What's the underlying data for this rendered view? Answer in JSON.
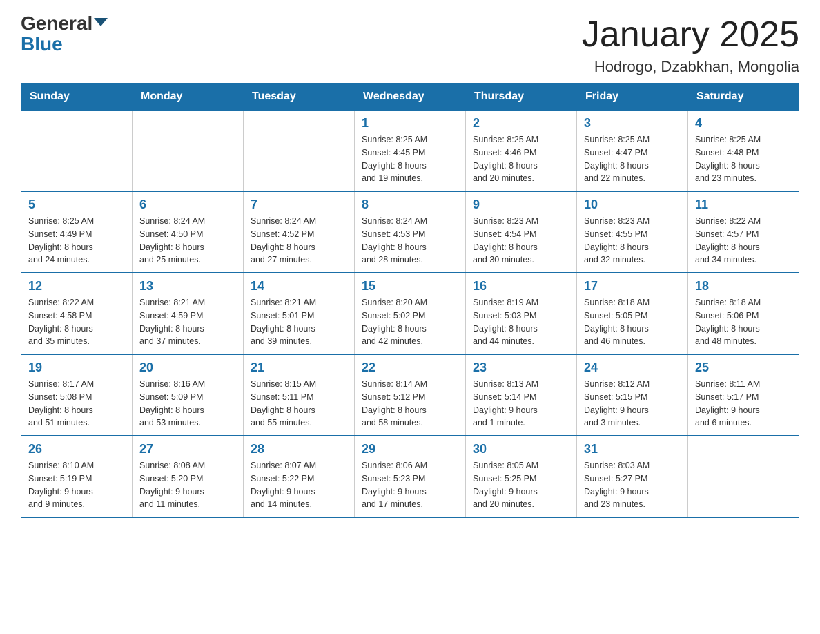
{
  "logo": {
    "general": "General",
    "blue": "Blue"
  },
  "title": "January 2025",
  "subtitle": "Hodrogo, Dzabkhan, Mongolia",
  "days_of_week": [
    "Sunday",
    "Monday",
    "Tuesday",
    "Wednesday",
    "Thursday",
    "Friday",
    "Saturday"
  ],
  "weeks": [
    [
      {
        "day": "",
        "info": ""
      },
      {
        "day": "",
        "info": ""
      },
      {
        "day": "",
        "info": ""
      },
      {
        "day": "1",
        "info": "Sunrise: 8:25 AM\nSunset: 4:45 PM\nDaylight: 8 hours\nand 19 minutes."
      },
      {
        "day": "2",
        "info": "Sunrise: 8:25 AM\nSunset: 4:46 PM\nDaylight: 8 hours\nand 20 minutes."
      },
      {
        "day": "3",
        "info": "Sunrise: 8:25 AM\nSunset: 4:47 PM\nDaylight: 8 hours\nand 22 minutes."
      },
      {
        "day": "4",
        "info": "Sunrise: 8:25 AM\nSunset: 4:48 PM\nDaylight: 8 hours\nand 23 minutes."
      }
    ],
    [
      {
        "day": "5",
        "info": "Sunrise: 8:25 AM\nSunset: 4:49 PM\nDaylight: 8 hours\nand 24 minutes."
      },
      {
        "day": "6",
        "info": "Sunrise: 8:24 AM\nSunset: 4:50 PM\nDaylight: 8 hours\nand 25 minutes."
      },
      {
        "day": "7",
        "info": "Sunrise: 8:24 AM\nSunset: 4:52 PM\nDaylight: 8 hours\nand 27 minutes."
      },
      {
        "day": "8",
        "info": "Sunrise: 8:24 AM\nSunset: 4:53 PM\nDaylight: 8 hours\nand 28 minutes."
      },
      {
        "day": "9",
        "info": "Sunrise: 8:23 AM\nSunset: 4:54 PM\nDaylight: 8 hours\nand 30 minutes."
      },
      {
        "day": "10",
        "info": "Sunrise: 8:23 AM\nSunset: 4:55 PM\nDaylight: 8 hours\nand 32 minutes."
      },
      {
        "day": "11",
        "info": "Sunrise: 8:22 AM\nSunset: 4:57 PM\nDaylight: 8 hours\nand 34 minutes."
      }
    ],
    [
      {
        "day": "12",
        "info": "Sunrise: 8:22 AM\nSunset: 4:58 PM\nDaylight: 8 hours\nand 35 minutes."
      },
      {
        "day": "13",
        "info": "Sunrise: 8:21 AM\nSunset: 4:59 PM\nDaylight: 8 hours\nand 37 minutes."
      },
      {
        "day": "14",
        "info": "Sunrise: 8:21 AM\nSunset: 5:01 PM\nDaylight: 8 hours\nand 39 minutes."
      },
      {
        "day": "15",
        "info": "Sunrise: 8:20 AM\nSunset: 5:02 PM\nDaylight: 8 hours\nand 42 minutes."
      },
      {
        "day": "16",
        "info": "Sunrise: 8:19 AM\nSunset: 5:03 PM\nDaylight: 8 hours\nand 44 minutes."
      },
      {
        "day": "17",
        "info": "Sunrise: 8:18 AM\nSunset: 5:05 PM\nDaylight: 8 hours\nand 46 minutes."
      },
      {
        "day": "18",
        "info": "Sunrise: 8:18 AM\nSunset: 5:06 PM\nDaylight: 8 hours\nand 48 minutes."
      }
    ],
    [
      {
        "day": "19",
        "info": "Sunrise: 8:17 AM\nSunset: 5:08 PM\nDaylight: 8 hours\nand 51 minutes."
      },
      {
        "day": "20",
        "info": "Sunrise: 8:16 AM\nSunset: 5:09 PM\nDaylight: 8 hours\nand 53 minutes."
      },
      {
        "day": "21",
        "info": "Sunrise: 8:15 AM\nSunset: 5:11 PM\nDaylight: 8 hours\nand 55 minutes."
      },
      {
        "day": "22",
        "info": "Sunrise: 8:14 AM\nSunset: 5:12 PM\nDaylight: 8 hours\nand 58 minutes."
      },
      {
        "day": "23",
        "info": "Sunrise: 8:13 AM\nSunset: 5:14 PM\nDaylight: 9 hours\nand 1 minute."
      },
      {
        "day": "24",
        "info": "Sunrise: 8:12 AM\nSunset: 5:15 PM\nDaylight: 9 hours\nand 3 minutes."
      },
      {
        "day": "25",
        "info": "Sunrise: 8:11 AM\nSunset: 5:17 PM\nDaylight: 9 hours\nand 6 minutes."
      }
    ],
    [
      {
        "day": "26",
        "info": "Sunrise: 8:10 AM\nSunset: 5:19 PM\nDaylight: 9 hours\nand 9 minutes."
      },
      {
        "day": "27",
        "info": "Sunrise: 8:08 AM\nSunset: 5:20 PM\nDaylight: 9 hours\nand 11 minutes."
      },
      {
        "day": "28",
        "info": "Sunrise: 8:07 AM\nSunset: 5:22 PM\nDaylight: 9 hours\nand 14 minutes."
      },
      {
        "day": "29",
        "info": "Sunrise: 8:06 AM\nSunset: 5:23 PM\nDaylight: 9 hours\nand 17 minutes."
      },
      {
        "day": "30",
        "info": "Sunrise: 8:05 AM\nSunset: 5:25 PM\nDaylight: 9 hours\nand 20 minutes."
      },
      {
        "day": "31",
        "info": "Sunrise: 8:03 AM\nSunset: 5:27 PM\nDaylight: 9 hours\nand 23 minutes."
      },
      {
        "day": "",
        "info": ""
      }
    ]
  ]
}
